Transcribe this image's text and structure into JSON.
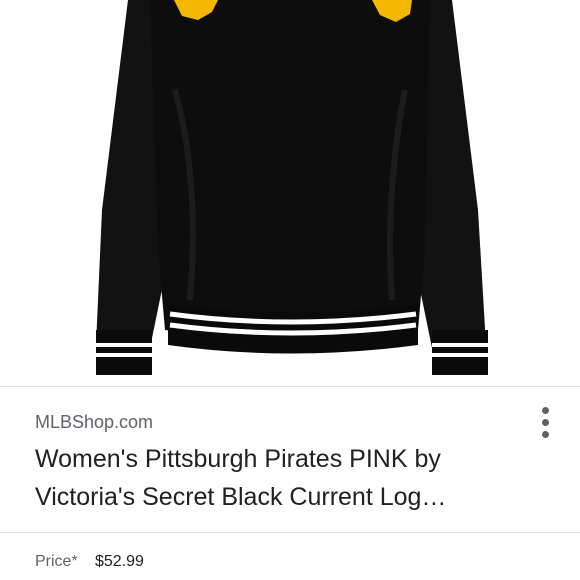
{
  "listing": {
    "image_alt_icon": "sweatshirt-image",
    "source": "MLBShop.com",
    "title_line1": "Women's Pittsburgh Pirates PINK by",
    "title_line2": "Victoria's Secret Black Current Log…",
    "menu_icon": "more-vert-icon",
    "price_label": "Price*",
    "price_value": "$52.99"
  },
  "colors": {
    "garment": "#0f0f0f",
    "logo_gold": "#f5b800",
    "stripe": "#ffffff"
  }
}
